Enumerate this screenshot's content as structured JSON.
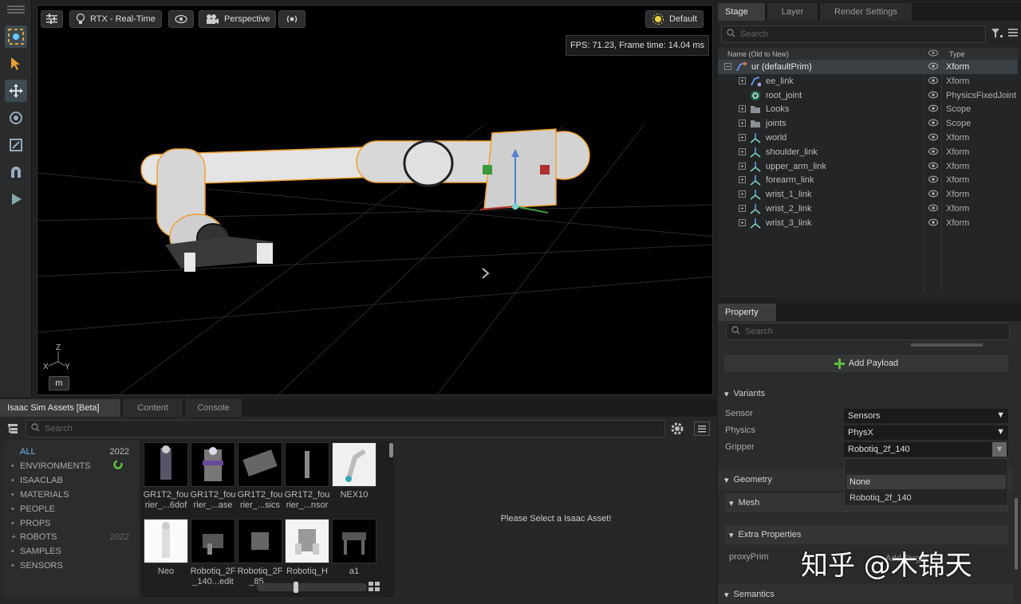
{
  "viewport": {
    "render_mode": "RTX - Real-Time",
    "camera": "Perspective",
    "lighting": "Default",
    "fps_text": "FPS: 71.23, Frame time: 14.04 ms",
    "axis_x": "X",
    "axis_y": "Y",
    "axis_z": "Z",
    "m_label": "m"
  },
  "stage": {
    "tabs": [
      "Stage",
      "Layer",
      "Render Settings"
    ],
    "search_placeholder": "Search",
    "col_name": "Name (Old to New)",
    "col_type": "Type",
    "rows": [
      {
        "name": "ur (defaultPrim)",
        "type": "Xform",
        "icon": "robot-icon",
        "level": 0,
        "expander": "−"
      },
      {
        "name": "ee_link",
        "type": "Xform",
        "icon": "link-icon",
        "level": 1,
        "expander": "+"
      },
      {
        "name": "root_joint",
        "type": "PhysicsFixedJoint",
        "icon": "joint-icon",
        "level": 1,
        "expander": ""
      },
      {
        "name": "Looks",
        "type": "Scope",
        "icon": "folder-icon",
        "level": 1,
        "expander": "+"
      },
      {
        "name": "joints",
        "type": "Scope",
        "icon": "folder-icon",
        "level": 1,
        "expander": "+"
      },
      {
        "name": "world",
        "type": "Xform",
        "icon": "xform-icon",
        "level": 1,
        "expander": "+"
      },
      {
        "name": "shoulder_link",
        "type": "Xform",
        "icon": "xform-icon",
        "level": 1,
        "expander": "+"
      },
      {
        "name": "upper_arm_link",
        "type": "Xform",
        "icon": "xform-icon",
        "level": 1,
        "expander": "+"
      },
      {
        "name": "forearm_link",
        "type": "Xform",
        "icon": "xform-icon",
        "level": 1,
        "expander": "+"
      },
      {
        "name": "wrist_1_link",
        "type": "Xform",
        "icon": "xform-icon",
        "level": 1,
        "expander": "+"
      },
      {
        "name": "wrist_2_link",
        "type": "Xform",
        "icon": "xform-icon",
        "level": 1,
        "expander": "+"
      },
      {
        "name": "wrist_3_link",
        "type": "Xform",
        "icon": "xform-icon",
        "level": 1,
        "expander": "+"
      }
    ]
  },
  "property": {
    "tab": "Property",
    "search_placeholder": "Search",
    "add_payload": "Add Payload",
    "variants_title": "Variants",
    "variants": [
      {
        "label": "Sensor",
        "value": "Sensors"
      },
      {
        "label": "Physics",
        "value": "PhysX"
      },
      {
        "label": "Gripper",
        "value": "Robotiq_2f_140"
      }
    ],
    "dropdown_options": [
      "None",
      "Robotiq_2f_140"
    ],
    "geometry_title": "Geometry",
    "mesh_title": "Mesh",
    "extra_title": "Extra Properties",
    "proxy_label": "proxyPrim",
    "proxy_button": "Add Target",
    "semantics_title": "Semantics"
  },
  "assets": {
    "tabs": [
      "Isaac Sim Assets [Beta]",
      "Content",
      "Console"
    ],
    "search_placeholder": "Search",
    "categories": [
      {
        "name": "ALL",
        "count": "2022"
      },
      {
        "name": "ENVIRONMENTS",
        "count": ""
      },
      {
        "name": "ISAACLAB",
        "count": ""
      },
      {
        "name": "MATERIALS",
        "count": ""
      },
      {
        "name": "PEOPLE",
        "count": ""
      },
      {
        "name": "PROPS",
        "count": ""
      },
      {
        "name": "ROBOTS",
        "count": "2022"
      },
      {
        "name": "SAMPLES",
        "count": ""
      },
      {
        "name": "SENSORS",
        "count": ""
      }
    ],
    "items": [
      {
        "label": "GR1T2_fou rier_...6dof"
      },
      {
        "label": "GR1T2_fou rier_...ase"
      },
      {
        "label": "GR1T2_fou rier_...sics"
      },
      {
        "label": "GR1T2_fou rier_...nsor"
      },
      {
        "label": "NEX10"
      },
      {
        "label": "Neo"
      },
      {
        "label": "Robotiq_2F _140...edit"
      },
      {
        "label": "Robotiq_2F _85..."
      },
      {
        "label": "Robotiq_H ..."
      },
      {
        "label": "a1"
      }
    ],
    "empty_message": "Please Select a Isaac Asset!"
  },
  "watermark": "知乎 @木锦天",
  "colors": {
    "selection_outline": "#f0a030",
    "accent_green": "#5fbf3f"
  }
}
